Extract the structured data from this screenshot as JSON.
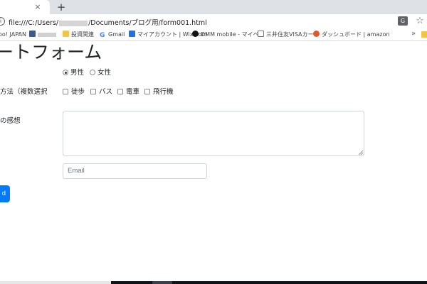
{
  "browser": {
    "tab_close_glyph": "×",
    "new_tab_glyph": "+",
    "url_prefix": "file:///C:/Users/",
    "url_suffix": "/Documents/ブログ用/form001.html",
    "bookmarks": [
      {
        "label": "oo! JAPAN",
        "icon": "yahoo-icon",
        "color": "#ffffff"
      },
      {
        "label": "",
        "icon": "facebook-icon",
        "color": "#3b5998"
      },
      {
        "label": "投資関連",
        "icon": "folder-icon",
        "color": "#f5c542"
      },
      {
        "label": "Gmail",
        "icon": "google-icon",
        "color": "#4285f4"
      },
      {
        "label": "マイアカウント | Wix.com",
        "icon": "wix-icon",
        "color": "#1a73e8"
      },
      {
        "label": "DMM mobile - マイペ",
        "icon": "dmm-icon",
        "color": "#111111"
      },
      {
        "label": "三井住友VISAカード",
        "icon": "page-icon",
        "color": "#ffffff"
      },
      {
        "label": "ダッシュボード | amazon",
        "icon": "amazon-icon",
        "color": "#e25a2b"
      }
    ],
    "more_glyph": "»"
  },
  "form": {
    "title": "ートフォーム",
    "gender_options": [
      {
        "label": "男性",
        "checked": true
      },
      {
        "label": "女性",
        "checked": false
      }
    ],
    "transport_label": "方法（複数選択",
    "transport_options": [
      {
        "label": "徒歩",
        "checked": false
      },
      {
        "label": "バス",
        "checked": false
      },
      {
        "label": "電車",
        "checked": false
      },
      {
        "label": "飛行機",
        "checked": false
      }
    ],
    "impression_label": "の感想",
    "impression_value": "",
    "email_placeholder": "Email",
    "submit_label": "d"
  },
  "colors": {
    "primary": "#007bff",
    "tabstrip": "#dee1e6"
  }
}
